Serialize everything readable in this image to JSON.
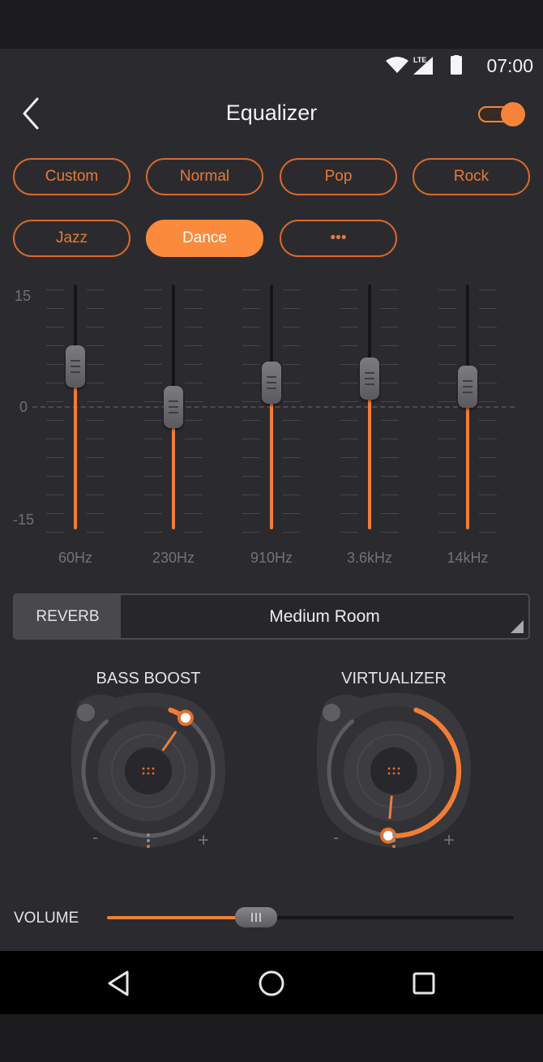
{
  "status_bar": {
    "time": "07:00",
    "network": "LTE",
    "icons": [
      "wifi-icon",
      "cell-signal-icon",
      "battery-icon"
    ]
  },
  "header": {
    "title": "Equalizer",
    "back_icon": "chevron-left-icon",
    "enabled": true
  },
  "presets": [
    {
      "label": "Custom",
      "active": false
    },
    {
      "label": "Normal",
      "active": false
    },
    {
      "label": "Pop",
      "active": false
    },
    {
      "label": "Rock",
      "active": false
    },
    {
      "label": "Jazz",
      "active": false
    },
    {
      "label": "Dance",
      "active": true
    },
    {
      "label": "•••",
      "active": false
    }
  ],
  "equalizer": {
    "scale_max": "15",
    "scale_zero": "0",
    "scale_min": "-15",
    "range_db": [
      -15,
      15
    ],
    "bands": [
      {
        "freq": "60Hz",
        "gain_db": 5
      },
      {
        "freq": "230Hz",
        "gain_db": 0
      },
      {
        "freq": "910Hz",
        "gain_db": 3
      },
      {
        "freq": "3.6kHz",
        "gain_db": 3.5
      },
      {
        "freq": "14kHz",
        "gain_db": 2.5
      }
    ]
  },
  "reverb": {
    "label": "REVERB",
    "value": "Medium Room"
  },
  "bass_boost": {
    "title": "BASS BOOST",
    "minus": "-",
    "plus": "+",
    "level": 0.05
  },
  "virtualizer": {
    "title": "VIRTUALIZER",
    "minus": "-",
    "plus": "+",
    "level": 0.55
  },
  "volume": {
    "label": "VOLUME",
    "level": 0.35
  },
  "colors": {
    "accent": "#f27d37",
    "background": "#2b2b2f",
    "panel": "#27272b"
  }
}
